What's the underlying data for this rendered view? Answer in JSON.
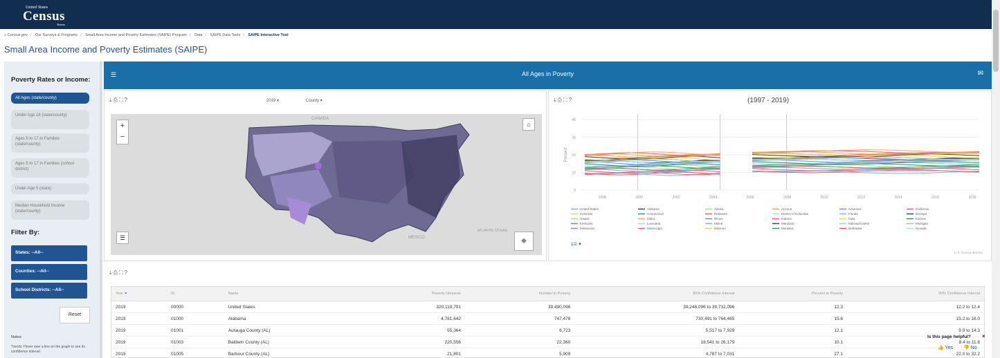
{
  "header": {
    "logo_top": "United States",
    "logo_main": "Census",
    "logo_bottom": "Bureau"
  },
  "breadcrumb": [
    "Census.gov",
    "Our Surveys & Programs",
    "Small Area Income and Poverty Estimates (SAIPE) Program",
    "Data",
    "SAIPE Data Tools",
    "SAIPE Interactive Tool"
  ],
  "page_title": "Small Area Income and Poverty Estimates (SAIPE)",
  "sidebar": {
    "title": "Poverty Rates or Income:",
    "options": [
      "All Ages (state/county)",
      "Under Age 18 (state/county)",
      "Ages 5 to 17 in Families (state/county)",
      "Ages 5 to 17 in Families (school district)",
      "Under Age 5 (state)",
      "Median Household Income (state/county)"
    ],
    "filter_title": "Filter By:",
    "filters": [
      "States: --All--",
      "Counties: --All--",
      "School Districts: --All--"
    ],
    "reset": "Reset",
    "notes_title": "Notes:",
    "notes_text": "Trends: Hover over a line on the graph to see its confidence interval."
  },
  "main_bar": {
    "title": "All Ages in Poverty"
  },
  "map_panel": {
    "year": "2019",
    "level": "County",
    "labels": [
      "CANADA",
      "MEXICO",
      "ATLANTIC OCEAN"
    ],
    "icons": [
      "download-icon",
      "print-icon",
      "fullscreen-icon",
      "help-icon"
    ]
  },
  "line_panel": {
    "title": "(1997 - 2019)",
    "source": "U.S. Census Bureau",
    "pager": "1/2",
    "chart_data": {
      "type": "line",
      "ylabel": "Percent",
      "ylim": [
        0,
        40
      ],
      "yticks": [
        0,
        10,
        20,
        30,
        40
      ],
      "xticks": [
        "1998",
        "2000",
        "2002",
        "2004",
        "2006",
        "2008",
        "2010",
        "2012",
        "2014",
        "2016",
        "2018"
      ],
      "series": [
        {
          "name": "United States",
          "color": "#7cb5ec"
        },
        {
          "name": "Alabama",
          "color": "#434348"
        },
        {
          "name": "Alaska",
          "color": "#90ed7d"
        },
        {
          "name": "Arizona",
          "color": "#f7a35c"
        },
        {
          "name": "Arkansas",
          "color": "#8085e9"
        },
        {
          "name": "California",
          "color": "#f15c80"
        },
        {
          "name": "Colorado",
          "color": "#e4d354"
        },
        {
          "name": "Connecticut",
          "color": "#2b908f"
        },
        {
          "name": "Delaware",
          "color": "#f45b5b"
        },
        {
          "name": "District of Columbia",
          "color": "#91e8e1"
        },
        {
          "name": "Florida",
          "color": "#7cb5ec"
        },
        {
          "name": "Georgia",
          "color": "#434348"
        },
        {
          "name": "Hawaii",
          "color": "#90ed7d"
        },
        {
          "name": "Idaho",
          "color": "#f7a35c"
        },
        {
          "name": "Illinois",
          "color": "#8085e9"
        },
        {
          "name": "Indiana",
          "color": "#f15c80"
        },
        {
          "name": "Iowa",
          "color": "#e4d354"
        },
        {
          "name": "Kansas",
          "color": "#2b908f"
        },
        {
          "name": "Kentucky",
          "color": "#f45b5b"
        },
        {
          "name": "Louisiana",
          "color": "#91e8e1"
        },
        {
          "name": "Maine",
          "color": "#7cb5ec"
        },
        {
          "name": "Maryland",
          "color": "#434348"
        },
        {
          "name": "Massachusetts",
          "color": "#90ed7d"
        },
        {
          "name": "Michigan",
          "color": "#f7a35c"
        },
        {
          "name": "Minnesota",
          "color": "#8085e9"
        },
        {
          "name": "Mississippi",
          "color": "#f15c80"
        },
        {
          "name": "Missouri",
          "color": "#e4d354"
        },
        {
          "name": "Montana",
          "color": "#2b908f"
        },
        {
          "name": "Nebraska",
          "color": "#f45b5b"
        },
        {
          "name": "Nevada",
          "color": "#91e8e1"
        }
      ]
    }
  },
  "table": {
    "headers": [
      "Year",
      "ID",
      "Name",
      "Poverty Universe",
      "Number in Poverty",
      "90% Confidence Interval",
      "Percent in Poverty",
      "90% Confidence Interval"
    ],
    "rows": [
      [
        "2019",
        "00000",
        "United States",
        "320,118,791",
        "39,490,096",
        "39,248,096 to 39,732,096",
        "12.3",
        "12.2 to 12.4"
      ],
      [
        "2019",
        "01000",
        "Alabama",
        "4,781,642",
        "747,478",
        "730,491 to 764,465",
        "15.6",
        "15.2 to 16.0"
      ],
      [
        "2019",
        "01001",
        "Autauga County (AL)",
        "55,364",
        "6,723",
        "5,517 to 7,929",
        "12.1",
        "9.9 to 14.3"
      ],
      [
        "2019",
        "01003",
        "Baldwin County (AL)",
        "220,556",
        "22,360",
        "18,541 to 26,179",
        "10.1",
        "8.4 to 11.8"
      ],
      [
        "2019",
        "01005",
        "Barbour County (AL)",
        "21,801",
        "5,909",
        "4,787 to 7,031",
        "27.1",
        "22.0 to 32.2"
      ]
    ]
  },
  "feedback": {
    "question": "Is this page helpful?",
    "yes": "Yes",
    "no": "No"
  }
}
